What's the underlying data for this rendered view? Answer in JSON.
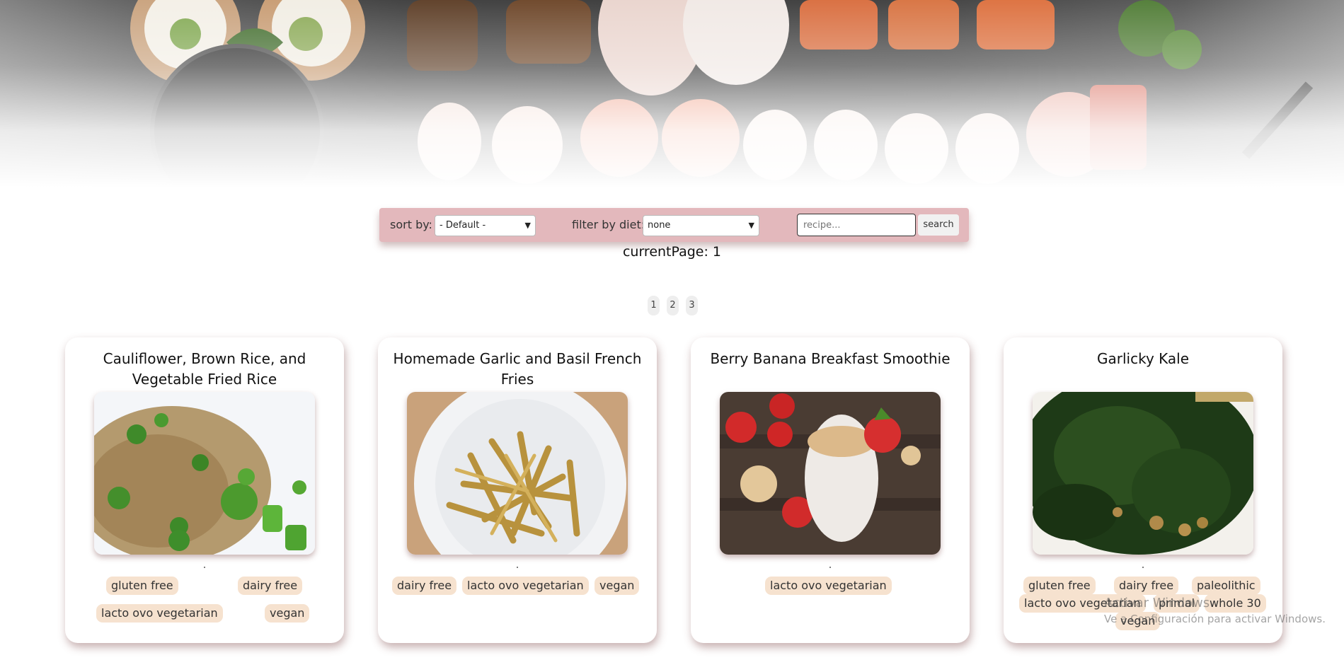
{
  "controls": {
    "sort_label": "sort by:",
    "sort_value": "- Default -",
    "filter_label": "filter by diet:",
    "filter_value": "none",
    "search_placeholder": "recipe...",
    "search_button": "search"
  },
  "status": {
    "current_page": "currentPage: 1"
  },
  "pagination": [
    "1",
    "2",
    "3"
  ],
  "cards": [
    {
      "title": "Cauliflower, Brown Rice, and Vegetable Fried Rice",
      "image": "fried-rice-photo",
      "tags": [
        "gluten free",
        "dairy free",
        "lacto ovo vegetarian",
        "vegan"
      ]
    },
    {
      "title": "Homemade Garlic and Basil French Fries",
      "image": "french-fries-photo",
      "tags": [
        "dairy free",
        "lacto ovo vegetarian",
        "vegan"
      ]
    },
    {
      "title": "Berry Banana Breakfast Smoothie",
      "image": "smoothie-photo",
      "tags": [
        "lacto ovo vegetarian"
      ]
    },
    {
      "title": "Garlicky Kale",
      "image": "kale-photo",
      "tags": [
        "gluten free",
        "dairy free",
        "paleolithic",
        "lacto ovo vegetarian",
        "primal",
        "whole 30",
        "vegan"
      ]
    }
  ],
  "watermark": {
    "line1": "Activar Windows",
    "line2": "Ve a Configuración para activar Windows."
  }
}
